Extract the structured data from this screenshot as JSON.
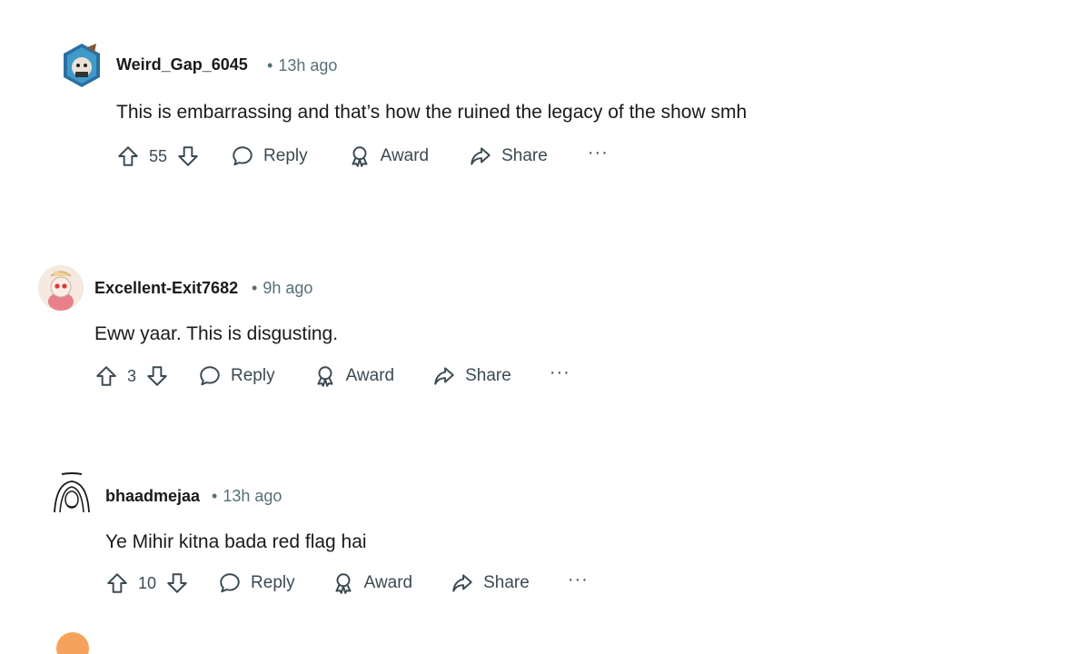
{
  "comments": [
    {
      "username": "Weird_Gap_6045",
      "separator": "•",
      "time": "13h ago",
      "text": "This is embarrassing and that’s how the ruined the legacy of the show smh",
      "votes": "55",
      "actions": {
        "reply": "Reply",
        "award": "Award",
        "share": "Share",
        "more": "···"
      }
    },
    {
      "username": "Excellent-Exit7682",
      "separator": "•",
      "time": "9h ago",
      "text": "Eww yaar. This is disgusting.",
      "votes": "3",
      "actions": {
        "reply": "Reply",
        "award": "Award",
        "share": "Share",
        "more": "···"
      }
    },
    {
      "username": "bhaadmejaa",
      "separator": "•",
      "time": "13h ago",
      "text": "Ye Mihir kitna bada red flag hai",
      "votes": "10",
      "actions": {
        "reply": "Reply",
        "award": "Award",
        "share": "Share",
        "more": "···"
      }
    }
  ],
  "colors": {
    "text": "#1a1a1b",
    "meta": "#576f76",
    "action": "#3b4a52"
  }
}
